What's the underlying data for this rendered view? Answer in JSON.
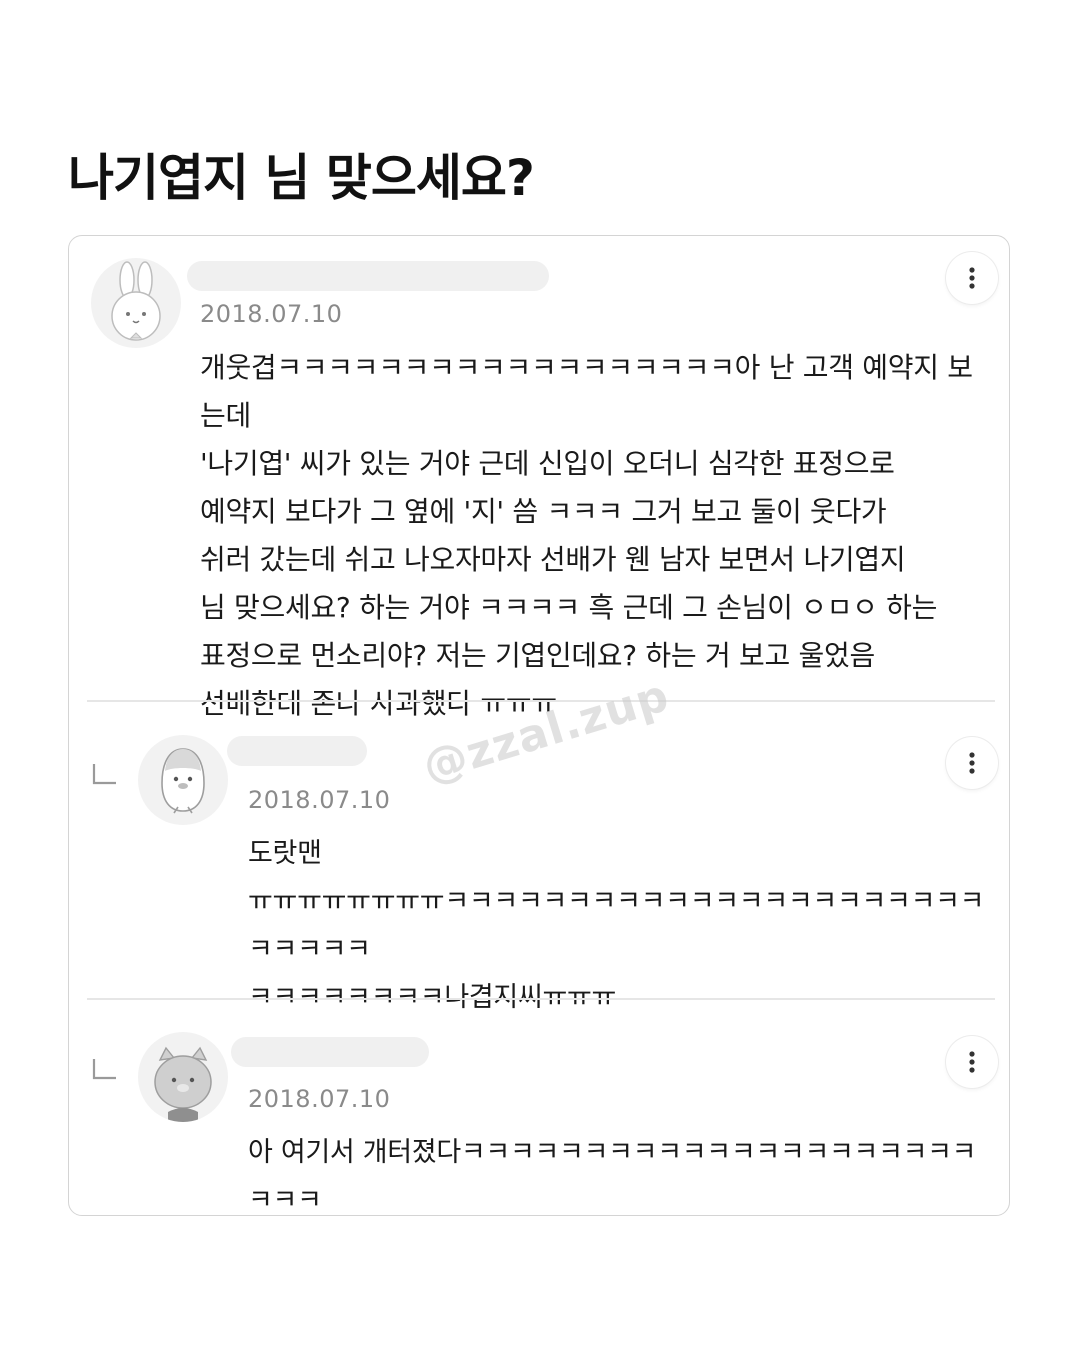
{
  "page": {
    "title": "나기엽지 님 맞으세요?"
  },
  "watermark": "@zzal.zup",
  "comments": [
    {
      "avatar_icon": "rabbit-avatar-icon",
      "date": "2018.07.10",
      "text": "개웃겹ㅋㅋㅋㅋㅋㅋㅋㅋㅋㅋㅋㅋㅋㅋㅋㅋㅋㅋ아 난 고객 예약지 보는데\n'나기엽' 씨가 있는 거야 근데 신입이 오더니 심각한 표정으로\n예약지 보다가 그 옆에 '지' 씀 ㅋㅋㅋ 그거 보고 둘이 웃다가\n쉬러 갔는데 쉬고 나오자마자 선배가 웬 남자 보면서 나기엽지\n님 맞으세요? 하는 거야 ㅋㅋㅋㅋ 흑 근데 그 손님이 ㅇㅁㅇ 하는\n표정으로 먼소리야? 저는 기엽인데요? 하는 거 보고 울었음\n선배한테 존나 사과했다 ㅠㅠㅠ"
    },
    {
      "avatar_icon": "penguin-avatar-icon",
      "date": "2018.07.10",
      "text": "도랏맨\nㅠㅠㅠㅠㅠㅠㅠㅠㅋㅋㅋㅋㅋㅋㅋㅋㅋㅋㅋㅋㅋㅋㅋㅋㅋㅋㅋㅋㅋㅋㅋㅋㅋㅋㅋ\nㅋㅋㅋㅋㅋㅋㅋㅋ나겹지씨ㅠㅠㅠ"
    },
    {
      "avatar_icon": "bear-avatar-icon",
      "date": "2018.07.10",
      "text": "아 여기서 개터졌다ㅋㅋㅋㅋㅋㅋㅋㅋㅋㅋㅋㅋㅋㅋㅋㅋㅋㅋㅋㅋㅋㅋㅋㅋ"
    }
  ]
}
